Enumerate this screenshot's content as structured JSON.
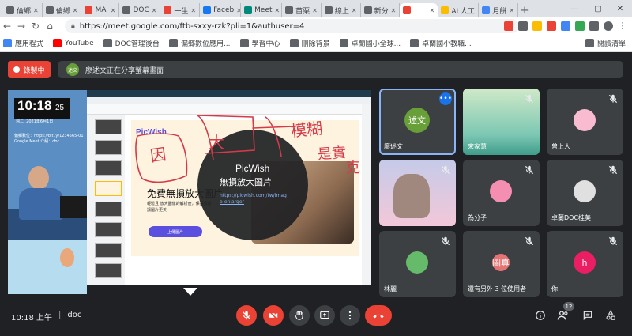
{
  "tabs": [
    {
      "label": "倫鄉",
      "color": "#5f6368"
    },
    {
      "label": "倫鄉",
      "color": "#5f6368"
    },
    {
      "label": "MA",
      "color": "#ea4335"
    },
    {
      "label": "DOC",
      "color": "#5f6368"
    },
    {
      "label": "一生",
      "color": "#ea4335"
    },
    {
      "label": "Faceb",
      "color": "#1877f2"
    },
    {
      "label": "Meet",
      "color": "#00897b"
    },
    {
      "label": "苗栗",
      "color": "#5f6368"
    },
    {
      "label": "線上",
      "color": "#5f6368"
    },
    {
      "label": "新分",
      "color": "#5f6368"
    },
    {
      "label": "",
      "color": "#ea4335"
    },
    {
      "label": "AI 人工",
      "color": "#fbbc04"
    },
    {
      "label": "月餅",
      "color": "#4285f4"
    }
  ],
  "browser": {
    "url": "https://meet.google.com/ftb-sxxy-rzk?pli=1&authuser=4",
    "new_tab": "+",
    "minimize": "—",
    "maximize": "▢",
    "close": "✕"
  },
  "bookmarks": [
    {
      "label": "應用程式",
      "color": "#4285f4"
    },
    {
      "label": "YouTube",
      "color": "#ff0000"
    },
    {
      "label": "DOC管理後台",
      "color": "#5f6368"
    },
    {
      "label": "偏鄉數位應用...",
      "color": "#5f6368"
    },
    {
      "label": "學習中心",
      "color": "#5f6368"
    },
    {
      "label": "刪除背景",
      "color": "#5f6368"
    },
    {
      "label": "卓蘭國小全球...",
      "color": "#5f6368"
    },
    {
      "label": "卓蘭國小教職...",
      "color": "#5f6368"
    }
  ],
  "reading_list": "閱讀清單",
  "recording": {
    "label": "錄製中"
  },
  "presenting": {
    "avatar_text": "述文",
    "text": "廖述文正在分享螢幕畫面"
  },
  "stage": {
    "clock": "10:18",
    "clock_seconds": "25",
    "clock_date": "週二, 2021年6月1日",
    "webcam_caption": "偏鄉數位：https://bit.ly/1234565-01",
    "webcam_caption2": "Google Meet 介紹：doc",
    "picwish_logo": "PicWish",
    "hero_title": "免費無損放大圖片",
    "hero_sub1": "輕鬆且 放大圖像的解析度，保持清晰",
    "hero_sub2": "讓圖片更美",
    "hero_button": "上傳圖片",
    "overlay_title": "PicWish",
    "overlay_sub": "無損放大圖片",
    "overlay_link": "https://picwish.com/tw/image-enlarger",
    "hand_note_1": "因",
    "hand_note_2": "大",
    "hand_note_3": "模糊",
    "hand_note_4": "是實",
    "hand_note_5": "克"
  },
  "participants": [
    {
      "name": "廖述文",
      "avatar": "述文",
      "color": "#689f38",
      "speaking": true
    },
    {
      "name": "宋家慧",
      "avatar": "",
      "color": "#4db6ac"
    },
    {
      "name": "曾上人",
      "avatar": "",
      "color": "#f8bbd0"
    },
    {
      "name": "",
      "avatar": "",
      "color": "#c5cae9"
    },
    {
      "name": "為分子",
      "avatar": "",
      "color": "#f48fb1"
    },
    {
      "name": "卓蘭DOC桂美",
      "avatar": "",
      "color": "#e0e0e0"
    },
    {
      "name": "林麗",
      "avatar": "",
      "color": "#66bb6a"
    },
    {
      "name": "還有另外 3 位使用者",
      "avatar": "圖真",
      "color": "#e57373"
    },
    {
      "name": "你",
      "avatar": "h",
      "color": "#e91e63"
    }
  ],
  "controls": {
    "time": "10:18 上午",
    "separator": "|",
    "meeting_code": "doc",
    "people_count": "12"
  }
}
